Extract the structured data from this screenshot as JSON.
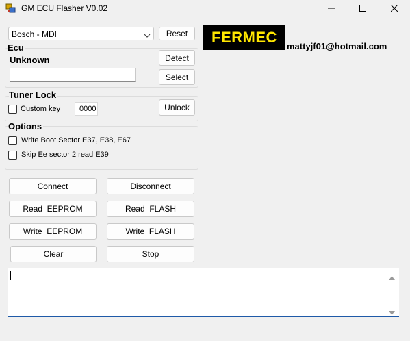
{
  "window": {
    "title": "GM ECU Flasher V0.02",
    "controls": {
      "minimize": "minimize-icon",
      "maximize": "maximize-icon",
      "close": "close-icon"
    }
  },
  "interface": {
    "selected": "Bosch - MDI",
    "reset_label": "Reset"
  },
  "ecu": {
    "group_title": "Ecu",
    "status": "Unknown",
    "input_value": "",
    "detect_label": "Detect",
    "select_label": "Select"
  },
  "tuner_lock": {
    "group_title": "Tuner Lock",
    "custom_key_label": "Custom key",
    "custom_key_checked": false,
    "key_value": "0000",
    "unlock_label": "Unlock"
  },
  "options": {
    "group_title": "Options",
    "items": [
      {
        "label": "Write Boot Sector E37, E38, E67",
        "checked": false
      },
      {
        "label": "Skip Ee sector 2 read E39",
        "checked": false
      }
    ]
  },
  "actions": {
    "connect": "Connect",
    "disconnect": "Disconnect",
    "read_eeprom": "Read  EEPROM",
    "read_flash": "Read  FLASH",
    "write_eeprom": "Write  EEPROM",
    "write_flash": "Write  FLASH",
    "clear": "Clear",
    "stop": "Stop"
  },
  "branding": {
    "logo_text": "FERMEC",
    "email": "mattyjf01@hotmail.com"
  },
  "log": {
    "text": ""
  }
}
